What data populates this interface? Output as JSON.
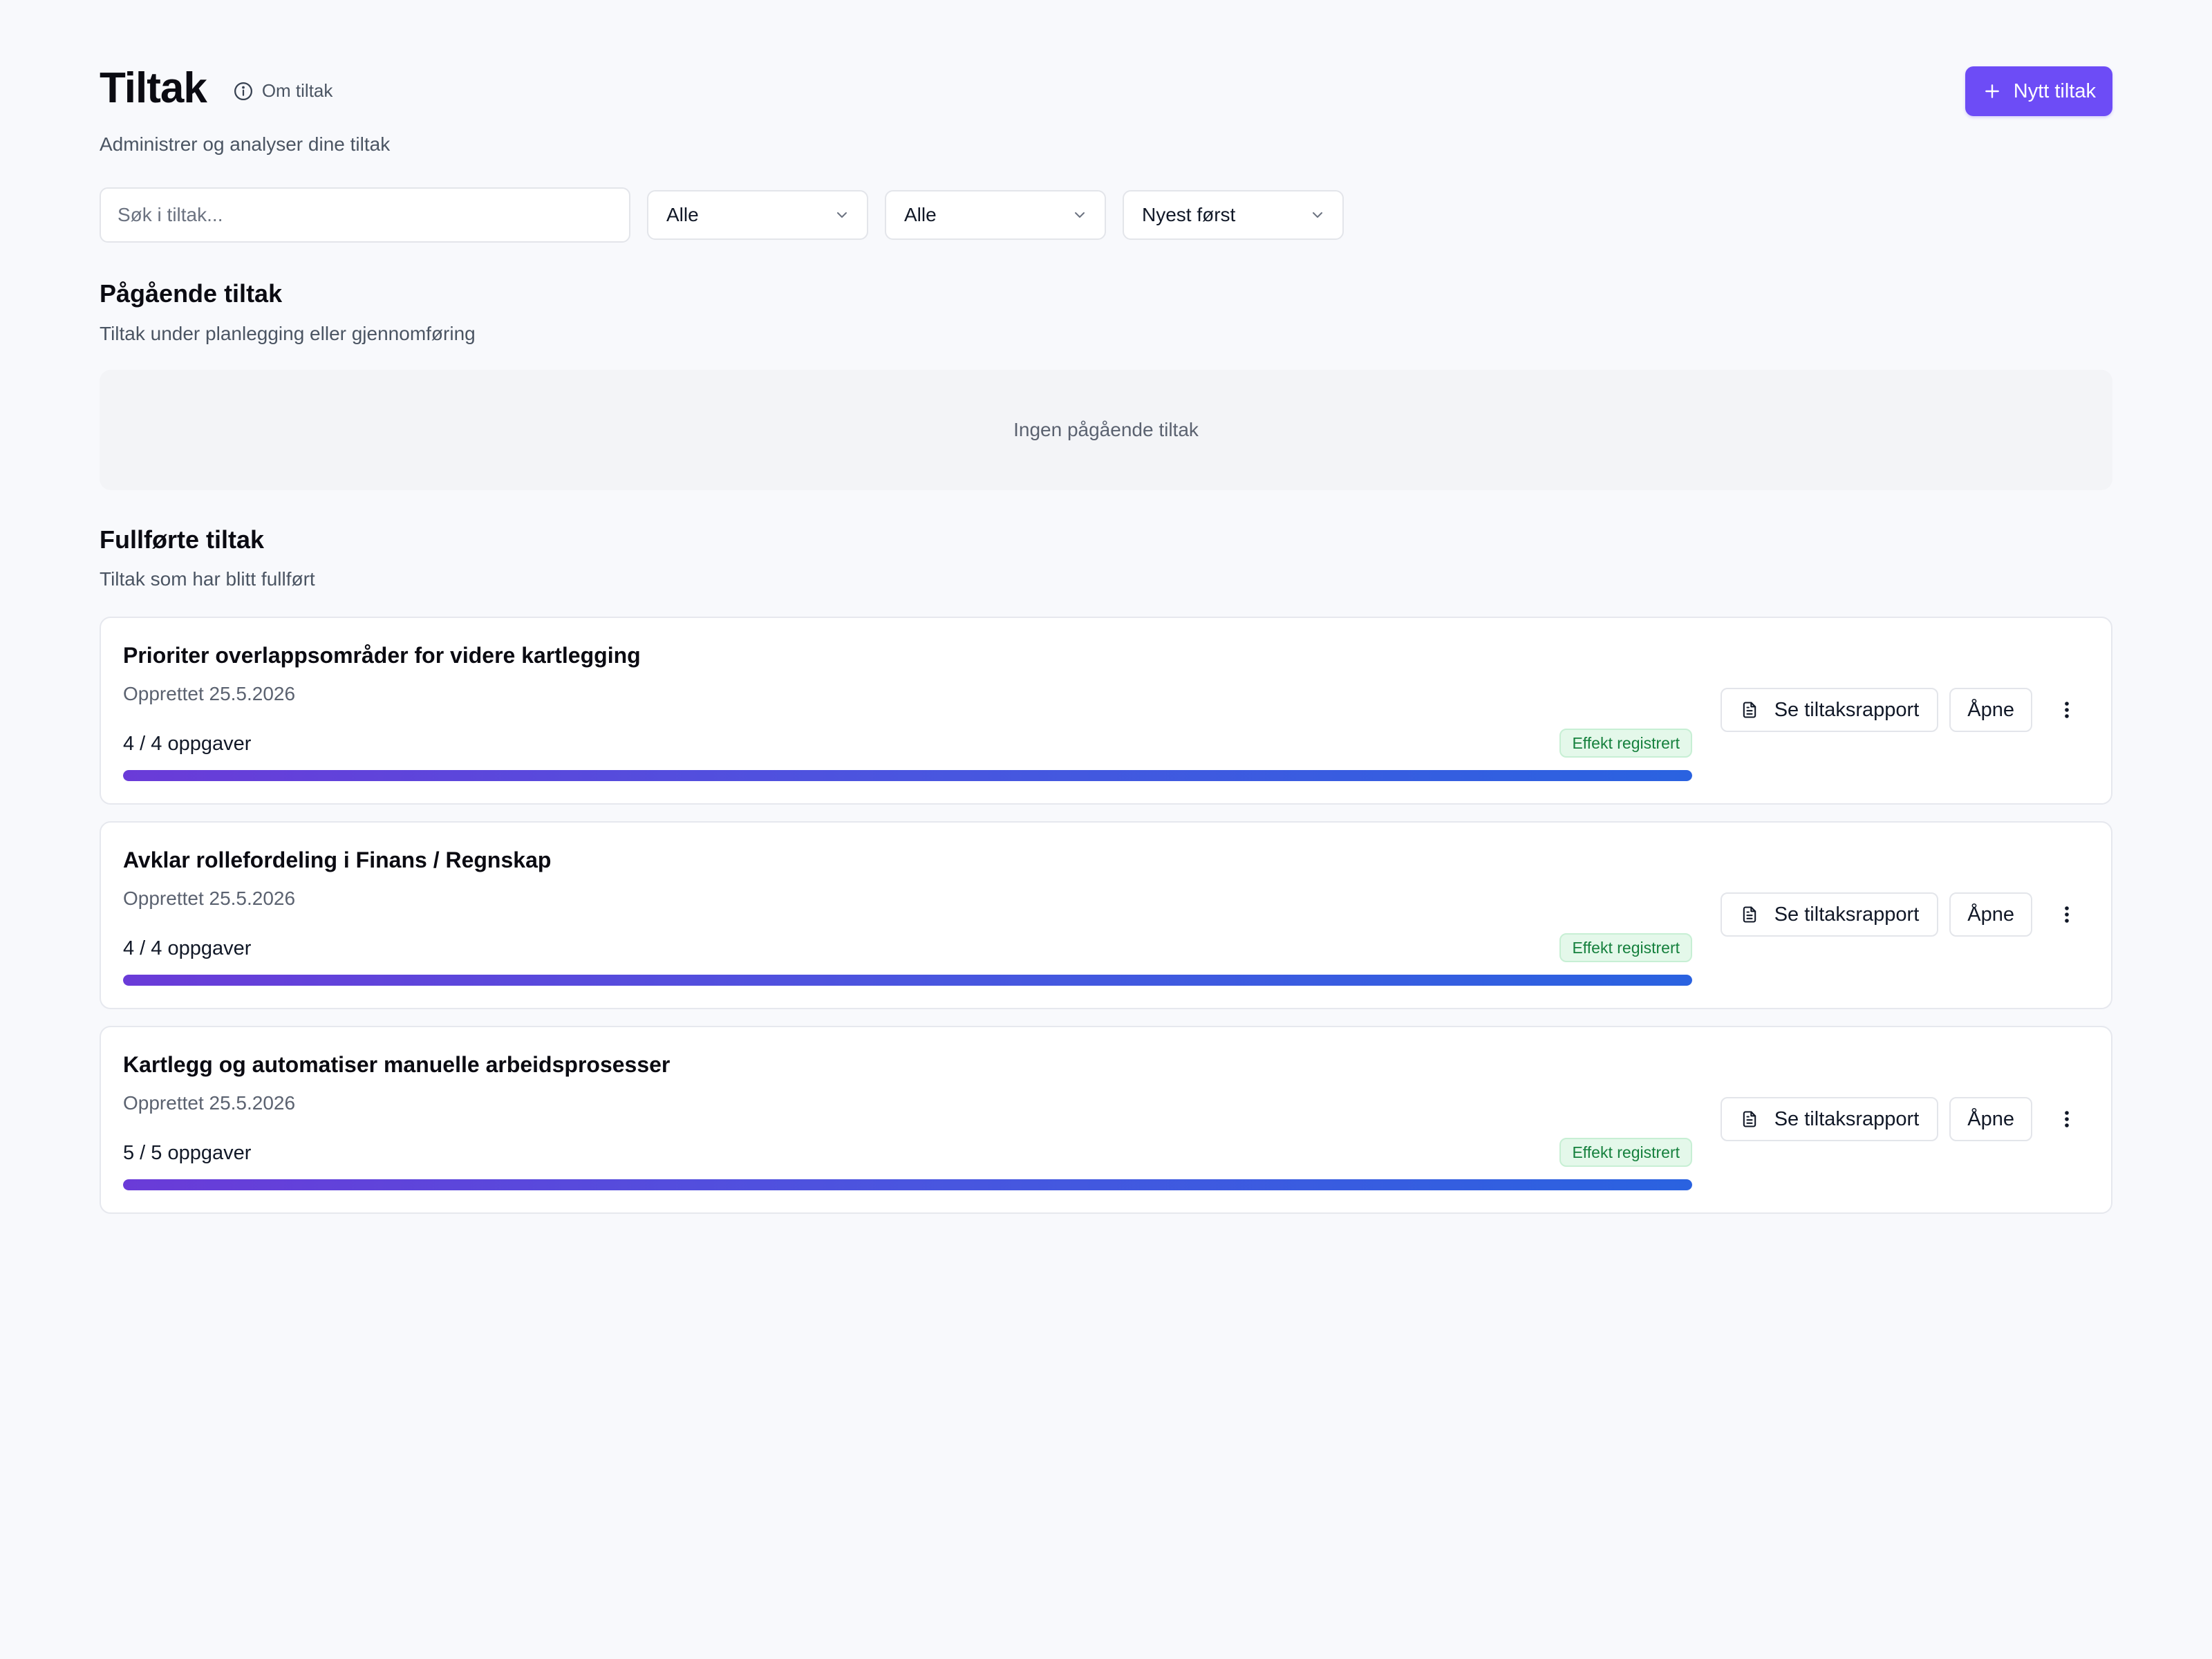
{
  "header": {
    "title": "Tiltak",
    "about_label": "Om tiltak",
    "subtitle": "Administrer og analyser dine tiltak",
    "new_button_label": "Nytt tiltak"
  },
  "filters": {
    "search_placeholder": "Søk i tiltak...",
    "status_value": "Alle",
    "category_value": "Alle",
    "sort_value": "Nyest først"
  },
  "ongoing": {
    "title": "Pågående tiltak",
    "subtitle": "Tiltak under planlegging eller gjennomføring",
    "empty_text": "Ingen pågående tiltak"
  },
  "completed": {
    "title": "Fullførte tiltak",
    "subtitle": "Tiltak som har blitt fullført",
    "items": [
      {
        "title": "Prioriter overlappsområder for videre kartlegging",
        "created": "Opprettet 25.5.2026",
        "tasks": "4 / 4 oppgaver",
        "badge": "Effekt registrert",
        "progress": 1.0,
        "report_label": "Se tiltaksrapport",
        "open_label": "Åpne"
      },
      {
        "title": "Avklar rollefordeling i Finans / Regnskap",
        "created": "Opprettet 25.5.2026",
        "tasks": "4 / 4 oppgaver",
        "badge": "Effekt registrert",
        "progress": 1.0,
        "report_label": "Se tiltaksrapport",
        "open_label": "Åpne"
      },
      {
        "title": "Kartlegg og automatiser manuelle arbeidsprosesser",
        "created": "Opprettet 25.5.2026",
        "tasks": "5 / 5 oppgaver",
        "badge": "Effekt registrert",
        "progress": 1.0,
        "report_label": "Se tiltaksrapport",
        "open_label": "Åpne"
      }
    ]
  },
  "colors": {
    "accent": "#6d4cf6",
    "badge_bg": "#e4f8ea",
    "badge_text": "#15803d",
    "progress_start": "#6a3bd8",
    "progress_end": "#2a62e0"
  },
  "icons": {
    "about": "info-circle-icon",
    "new": "plus-icon",
    "select": "chevron-down-icon",
    "report": "document-icon",
    "more": "more-vertical-icon"
  }
}
